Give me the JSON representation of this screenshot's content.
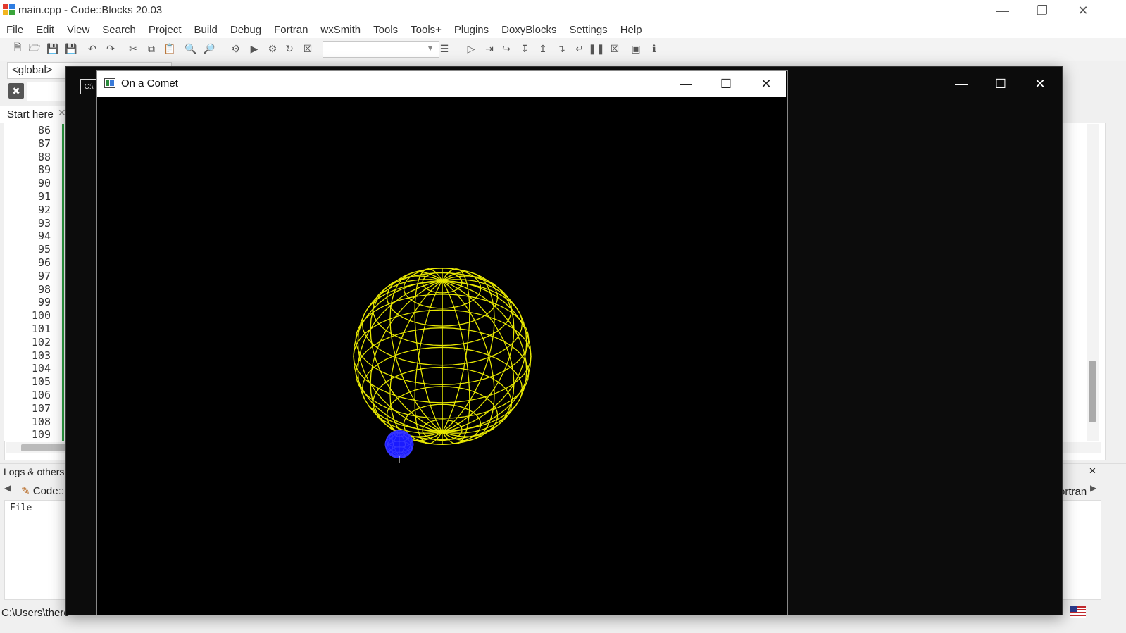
{
  "ide": {
    "title": "main.cpp - Code::Blocks 20.03",
    "menu": [
      "File",
      "Edit",
      "View",
      "Search",
      "Project",
      "Build",
      "Debug",
      "Fortran",
      "wxSmith",
      "Tools",
      "Tools+",
      "Plugins",
      "DoxyBlocks",
      "Settings",
      "Help"
    ],
    "scope_combo": "<global>",
    "editor_tab": "Start here",
    "line_numbers": [
      "86",
      "87",
      "88",
      "89",
      "90",
      "91",
      "92",
      "93",
      "94",
      "95",
      "96",
      "97",
      "98",
      "99",
      "100",
      "101",
      "102",
      "103",
      "104",
      "105",
      "106",
      "107",
      "108",
      "109"
    ],
    "logs_panel_title": "Logs & others",
    "logs_tab_label": "Code::",
    "logs_right_tab_label": "ortran",
    "logs_column_header": "File",
    "status_path": "C:\\Users\\there"
  },
  "gl_window": {
    "title": "On a Comet",
    "comet_color": "#e8e800",
    "ship_color": "#1a1aff"
  },
  "colors": {
    "console_bg": "#0c0c0c",
    "gutter_marker": "#2ea043"
  }
}
